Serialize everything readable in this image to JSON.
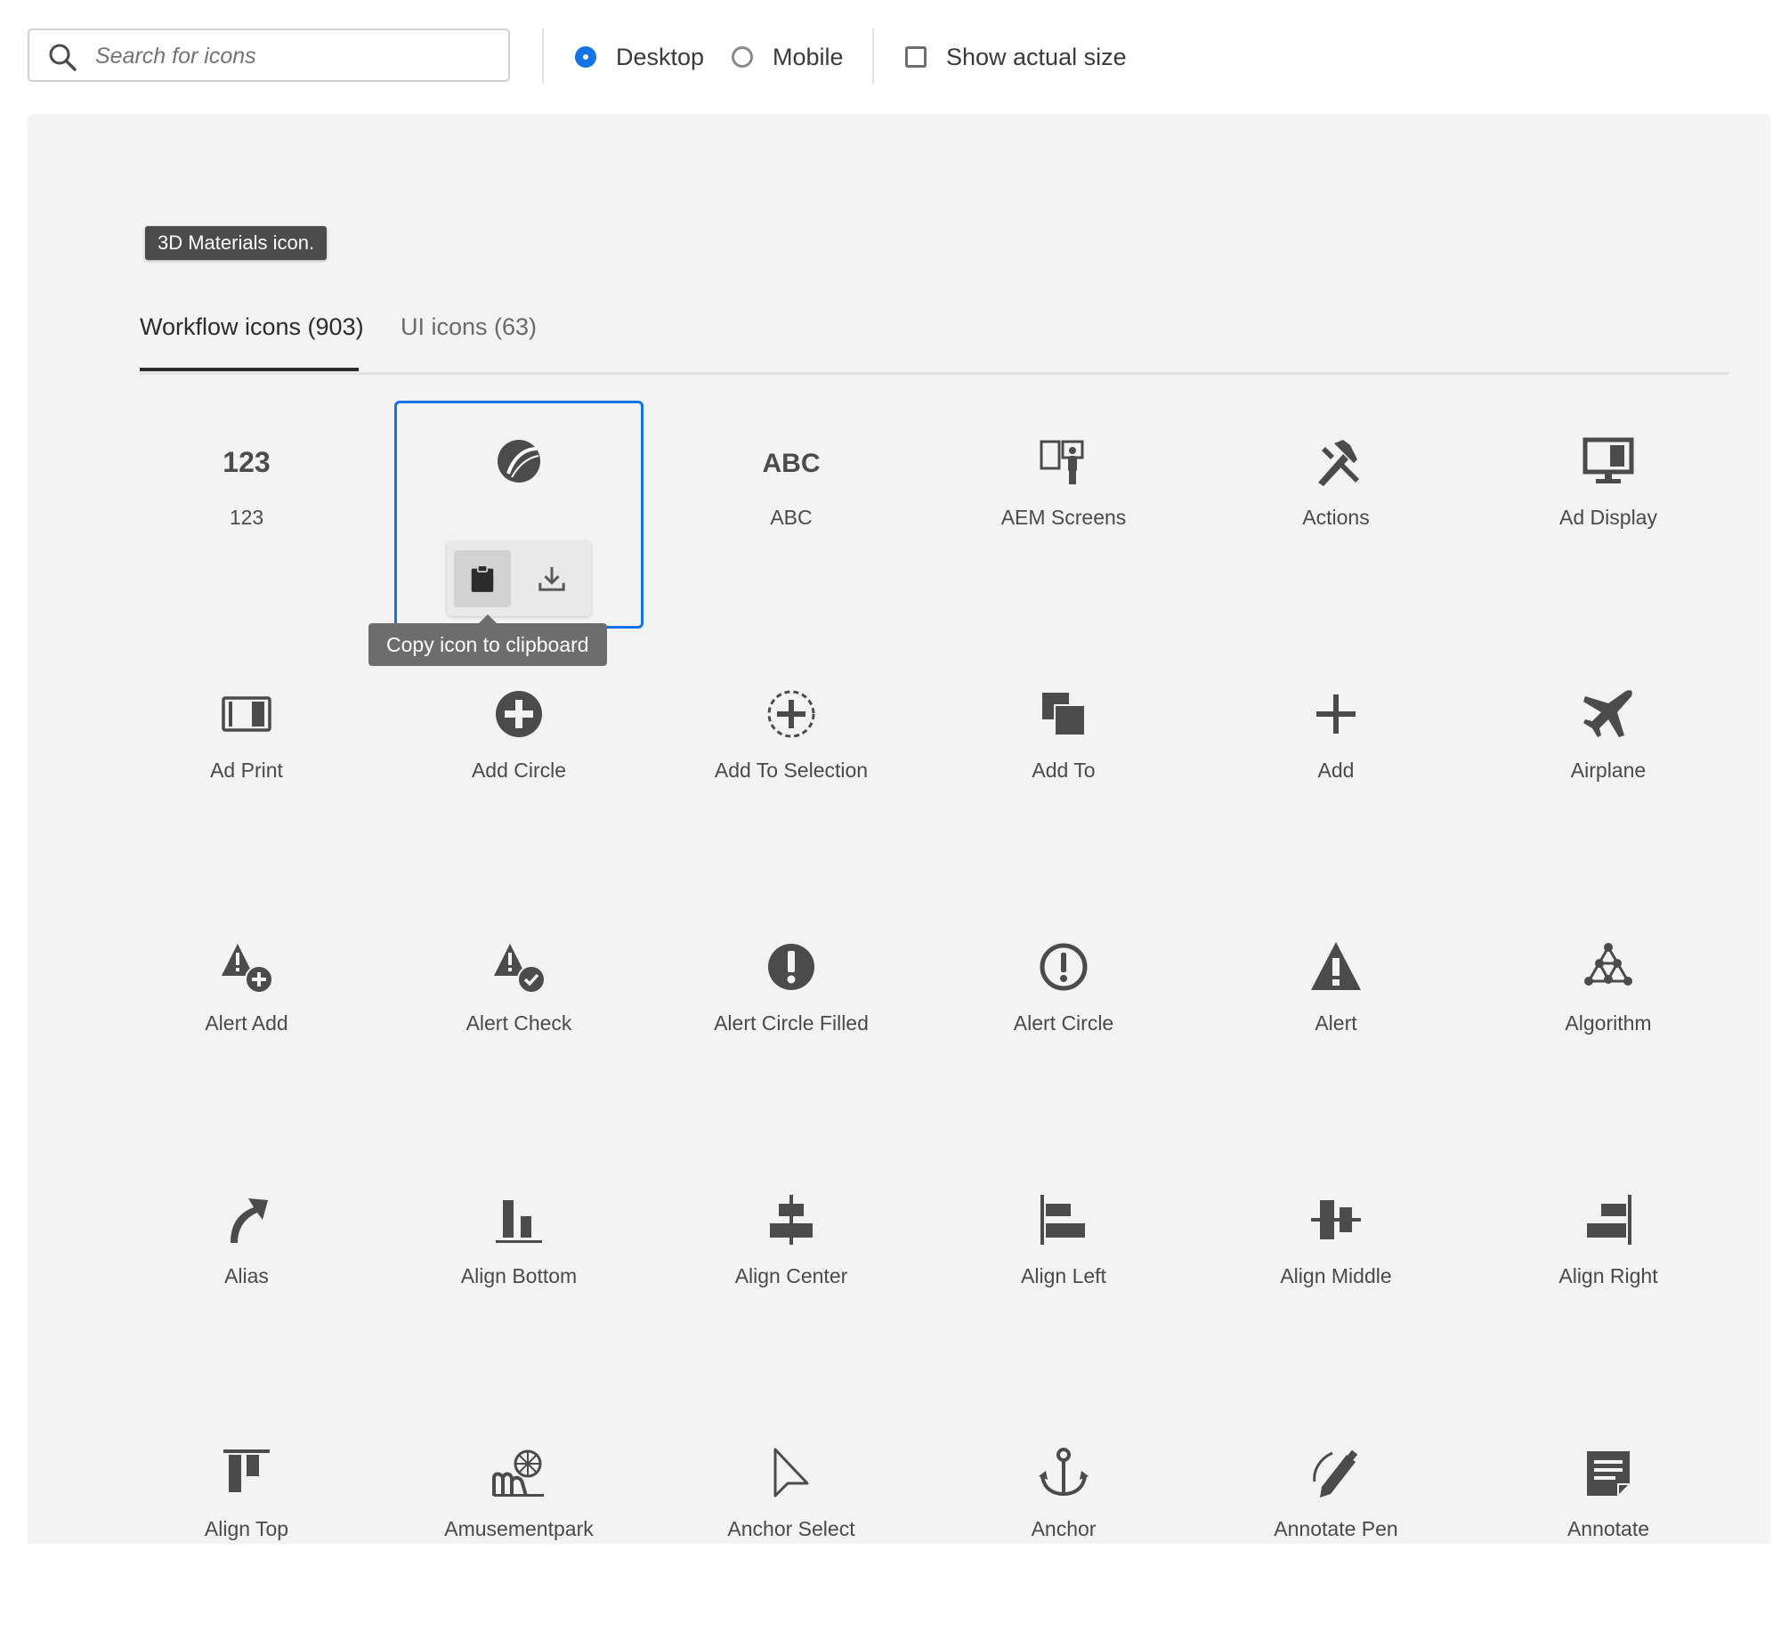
{
  "search": {
    "placeholder": "Search for icons",
    "value": ""
  },
  "platform": {
    "options": [
      {
        "label": "Desktop",
        "checked": true
      },
      {
        "label": "Mobile",
        "checked": false
      }
    ]
  },
  "show_actual_size": {
    "label": "Show actual size",
    "checked": false
  },
  "hover_tooltip": "3D Materials icon.",
  "tabs": [
    {
      "label": "Workflow icons (903)",
      "active": true
    },
    {
      "label": "UI icons (63)",
      "active": false
    }
  ],
  "selected_icon": {
    "copy_tooltip": "Copy icon to clipboard",
    "actions": [
      "clipboard-icon",
      "download-icon"
    ]
  },
  "icons": [
    {
      "name": "123",
      "icon": "text-123"
    },
    {
      "name": "",
      "icon": "3d-materials-icon",
      "selected": true
    },
    {
      "name": "ABC",
      "icon": "text-abc"
    },
    {
      "name": "AEM Screens",
      "icon": "aem-screens-icon"
    },
    {
      "name": "Actions",
      "icon": "actions-icon"
    },
    {
      "name": "Ad Display",
      "icon": "ad-display-icon"
    },
    {
      "name": "Ad Print",
      "icon": "ad-print-icon"
    },
    {
      "name": "Add Circle",
      "icon": "add-circle-icon"
    },
    {
      "name": "Add To Selection",
      "icon": "add-to-selection-icon"
    },
    {
      "name": "Add To",
      "icon": "add-to-icon"
    },
    {
      "name": "Add",
      "icon": "add-icon"
    },
    {
      "name": "Airplane",
      "icon": "airplane-icon"
    },
    {
      "name": "Alert Add",
      "icon": "alert-add-icon"
    },
    {
      "name": "Alert Check",
      "icon": "alert-check-icon"
    },
    {
      "name": "Alert Circle Filled",
      "icon": "alert-circle-filled-icon"
    },
    {
      "name": "Alert Circle",
      "icon": "alert-circle-icon"
    },
    {
      "name": "Alert",
      "icon": "alert-icon"
    },
    {
      "name": "Algorithm",
      "icon": "algorithm-icon"
    },
    {
      "name": "Alias",
      "icon": "alias-icon"
    },
    {
      "name": "Align Bottom",
      "icon": "align-bottom-icon"
    },
    {
      "name": "Align Center",
      "icon": "align-center-icon"
    },
    {
      "name": "Align Left",
      "icon": "align-left-icon"
    },
    {
      "name": "Align Middle",
      "icon": "align-middle-icon"
    },
    {
      "name": "Align Right",
      "icon": "align-right-icon"
    },
    {
      "name": "Align Top",
      "icon": "align-top-icon"
    },
    {
      "name": "Amusementpark",
      "icon": "amusementpark-icon"
    },
    {
      "name": "Anchor Select",
      "icon": "anchor-select-icon"
    },
    {
      "name": "Anchor",
      "icon": "anchor-icon"
    },
    {
      "name": "Annotate Pen",
      "icon": "annotate-pen-icon"
    },
    {
      "name": "Annotate",
      "icon": "annotate-icon"
    }
  ],
  "colors": {
    "accent": "#1473e6",
    "icon": "#4b4b4b",
    "panel": "#f3f3f3"
  }
}
